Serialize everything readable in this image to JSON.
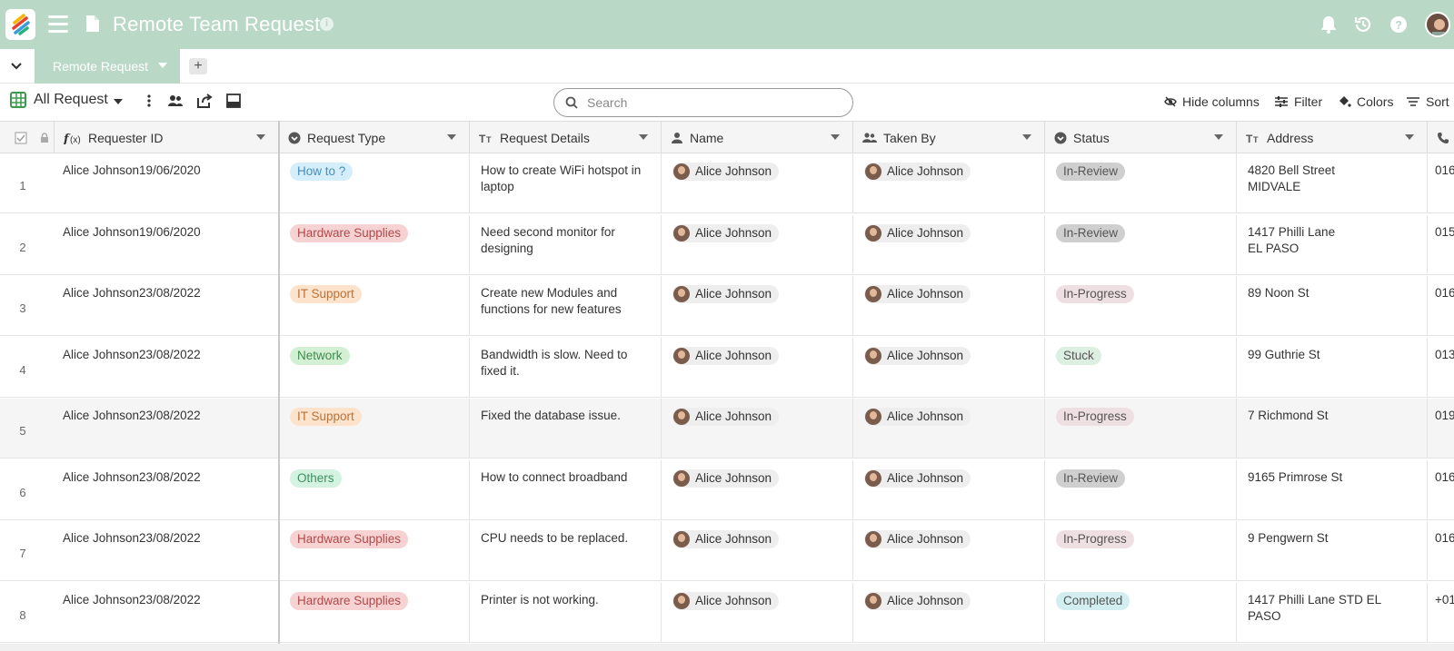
{
  "header": {
    "title": "Remote Team Request",
    "icons": [
      "logo-icon",
      "menu-icon",
      "document-icon",
      "info-icon",
      "bell-icon",
      "history-icon",
      "help-icon",
      "user-avatar"
    ]
  },
  "tabs": {
    "active_label": "Remote Request",
    "add_label": "+"
  },
  "toolbar": {
    "view_name": "All Request",
    "search_placeholder": "Search",
    "hide_columns_label": "Hide columns",
    "filter_label": "Filter",
    "colors_label": "Colors",
    "sort_label": "Sort"
  },
  "columns": [
    {
      "label": "Requester ID",
      "icon": "formula-icon"
    },
    {
      "label": "Request Type",
      "icon": "single-select-icon"
    },
    {
      "label": "Request Details",
      "icon": "text-icon"
    },
    {
      "label": "Name",
      "icon": "person-icon"
    },
    {
      "label": "Taken By",
      "icon": "people-icon"
    },
    {
      "label": "Status",
      "icon": "single-select-icon"
    },
    {
      "label": "Address",
      "icon": "text-icon"
    },
    {
      "label": "",
      "icon": "phone-icon"
    }
  ],
  "colors": {
    "header_bg": "#b9d9c6",
    "how_to": "#d4eefb",
    "hardware": "#f6d2d2",
    "it_support": "#fde3cc",
    "network": "#d3f0d5",
    "others": "#d3f3e0",
    "in_review": "#cfcfcf",
    "in_progress": "#eedfe3",
    "stuck": "#dcefe0",
    "completed": "#d2eef0"
  },
  "rows": [
    {
      "num": "1",
      "requester": "Alice Johnson19/06/2020",
      "type": "How to ?",
      "type_color": "#d4eefb",
      "type_text": "#4a8fb8",
      "details": "How to create WiFi hotspot in laptop",
      "name": "Alice Johnson",
      "taken_by": "Alice Johnson",
      "status": "In-Review",
      "status_color": "#cfcfcf",
      "address": "4820 Bell Street\nMIDVALE",
      "phone": "016"
    },
    {
      "num": "2",
      "requester": "Alice Johnson19/06/2020",
      "type": "Hardware Supplies",
      "type_color": "#f6d2d2",
      "type_text": "#b04a4a",
      "details": "Need second monitor for designing",
      "name": "Alice Johnson",
      "taken_by": "Alice Johnson",
      "status": "In-Review",
      "status_color": "#cfcfcf",
      "address": "1417 Philli Lane\nEL PASO",
      "phone": "015"
    },
    {
      "num": "3",
      "requester": "Alice Johnson23/08/2022",
      "type": "IT Support",
      "type_color": "#fde3cc",
      "type_text": "#b8733a",
      "details": "Create new Modules and functions for new features",
      "name": "Alice Johnson",
      "taken_by": "Alice Johnson",
      "status": "In-Progress",
      "status_color": "#eedfe3",
      "address": "89 Noon St",
      "phone": "016"
    },
    {
      "num": "4",
      "requester": "Alice Johnson23/08/2022",
      "type": "Network",
      "type_color": "#d3f0d5",
      "type_text": "#3f8a4a",
      "details": "Bandwidth is slow. Need to fixed it.",
      "name": "Alice Johnson",
      "taken_by": "Alice Johnson",
      "status": "Stuck",
      "status_color": "#dcefe0",
      "address": "99 Guthrie St",
      "phone": "013"
    },
    {
      "num": "5",
      "requester": "Alice Johnson23/08/2022",
      "type": "IT Support",
      "type_color": "#fde3cc",
      "type_text": "#b8733a",
      "details": "Fixed the database issue.",
      "name": "Alice Johnson",
      "taken_by": "Alice Johnson",
      "status": "In-Progress",
      "status_color": "#eedfe3",
      "address": "7 Richmond St",
      "phone": "019"
    },
    {
      "num": "6",
      "requester": "Alice Johnson23/08/2022",
      "type": "Others",
      "type_color": "#d3f3e0",
      "type_text": "#3f8f62",
      "details": "How to connect broadband",
      "name": "Alice Johnson",
      "taken_by": "Alice Johnson",
      "status": "In-Review",
      "status_color": "#cfcfcf",
      "address": "9165 Primrose St",
      "phone": "016"
    },
    {
      "num": "7",
      "requester": "Alice Johnson23/08/2022",
      "type": "Hardware Supplies",
      "type_color": "#f6d2d2",
      "type_text": "#b04a4a",
      "details": "CPU needs to be replaced.",
      "name": "Alice Johnson",
      "taken_by": "Alice Johnson",
      "status": "In-Progress",
      "status_color": "#eedfe3",
      "address": "9 Pengwern St",
      "phone": "016"
    },
    {
      "num": "8",
      "requester": "Alice Johnson23/08/2022",
      "type": "Hardware Supplies",
      "type_color": "#f6d2d2",
      "type_text": "#b04a4a",
      "details": "Printer is not working.",
      "name": "Alice Johnson",
      "taken_by": "Alice Johnson",
      "status": "Completed",
      "status_color": "#d2eef0",
      "address": "1417 Philli Lane STD EL PASO",
      "phone": "+01"
    }
  ]
}
